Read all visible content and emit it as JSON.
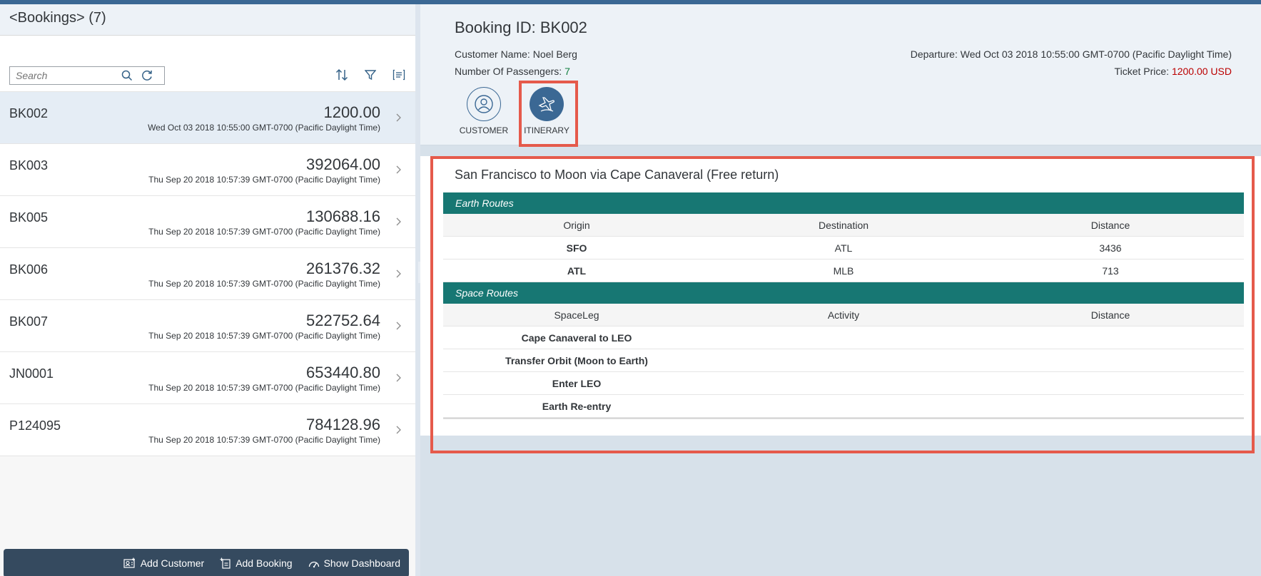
{
  "master": {
    "title": "<Bookings> (7)",
    "search_placeholder": "Search",
    "items": [
      {
        "id": "BK002",
        "amount": "1200.00",
        "date": "Wed Oct 03 2018 10:55:00 GMT-0700 (Pacific Daylight Time)",
        "selected": true
      },
      {
        "id": "BK003",
        "amount": "392064.00",
        "date": "Thu Sep 20 2018 10:57:39 GMT-0700 (Pacific Daylight Time)"
      },
      {
        "id": "BK005",
        "amount": "130688.16",
        "date": "Thu Sep 20 2018 10:57:39 GMT-0700 (Pacific Daylight Time)"
      },
      {
        "id": "BK006",
        "amount": "261376.32",
        "date": "Thu Sep 20 2018 10:57:39 GMT-0700 (Pacific Daylight Time)"
      },
      {
        "id": "BK007",
        "amount": "522752.64",
        "date": "Thu Sep 20 2018 10:57:39 GMT-0700 (Pacific Daylight Time)"
      },
      {
        "id": "JN0001",
        "amount": "653440.80",
        "date": "Thu Sep 20 2018 10:57:39 GMT-0700 (Pacific Daylight Time)"
      },
      {
        "id": "P124095",
        "amount": "784128.96",
        "date": "Thu Sep 20 2018 10:57:39 GMT-0700 (Pacific Daylight Time)"
      }
    ],
    "footer": {
      "add_customer": "Add Customer",
      "add_booking": "Add Booking",
      "show_dashboard": "Show Dashboard"
    }
  },
  "detail": {
    "title": "Booking ID: BK002",
    "customer_label": "Customer Name: ",
    "customer_value": "Noel Berg",
    "passengers_label": "Number Of Passengers: ",
    "passengers_value": "7",
    "departure": "Departure: Wed Oct 03 2018 10:55:00 GMT-0700 (Pacific Daylight Time)",
    "price_label": "Ticket Price: ",
    "price_value": "1200.00 USD",
    "tabs": {
      "customer": "CUSTOMER",
      "itinerary": "ITINERARY"
    },
    "itinerary": {
      "title": "San Francisco to Moon via Cape Canaveral (Free return)",
      "earth": {
        "group": "Earth Routes",
        "headers": [
          "Origin",
          "Destination",
          "Distance"
        ],
        "rows": [
          [
            "SFO",
            "ATL",
            "3436"
          ],
          [
            "ATL",
            "MLB",
            "713"
          ]
        ]
      },
      "space": {
        "group": "Space Routes",
        "headers": [
          "SpaceLeg",
          "Activity",
          "Distance"
        ],
        "rows": [
          [
            "Cape Canaveral to LEO",
            "",
            ""
          ],
          [
            "Transfer Orbit (Moon to Earth)",
            "",
            ""
          ],
          [
            "Enter LEO",
            "",
            ""
          ],
          [
            "Earth Re-entry",
            "",
            ""
          ]
        ]
      }
    }
  },
  "colors": {
    "accent": "#3b6894",
    "group_header": "#177773",
    "highlight": "#e55a4b",
    "positive": "#107e3e",
    "negative": "#bb0000"
  }
}
